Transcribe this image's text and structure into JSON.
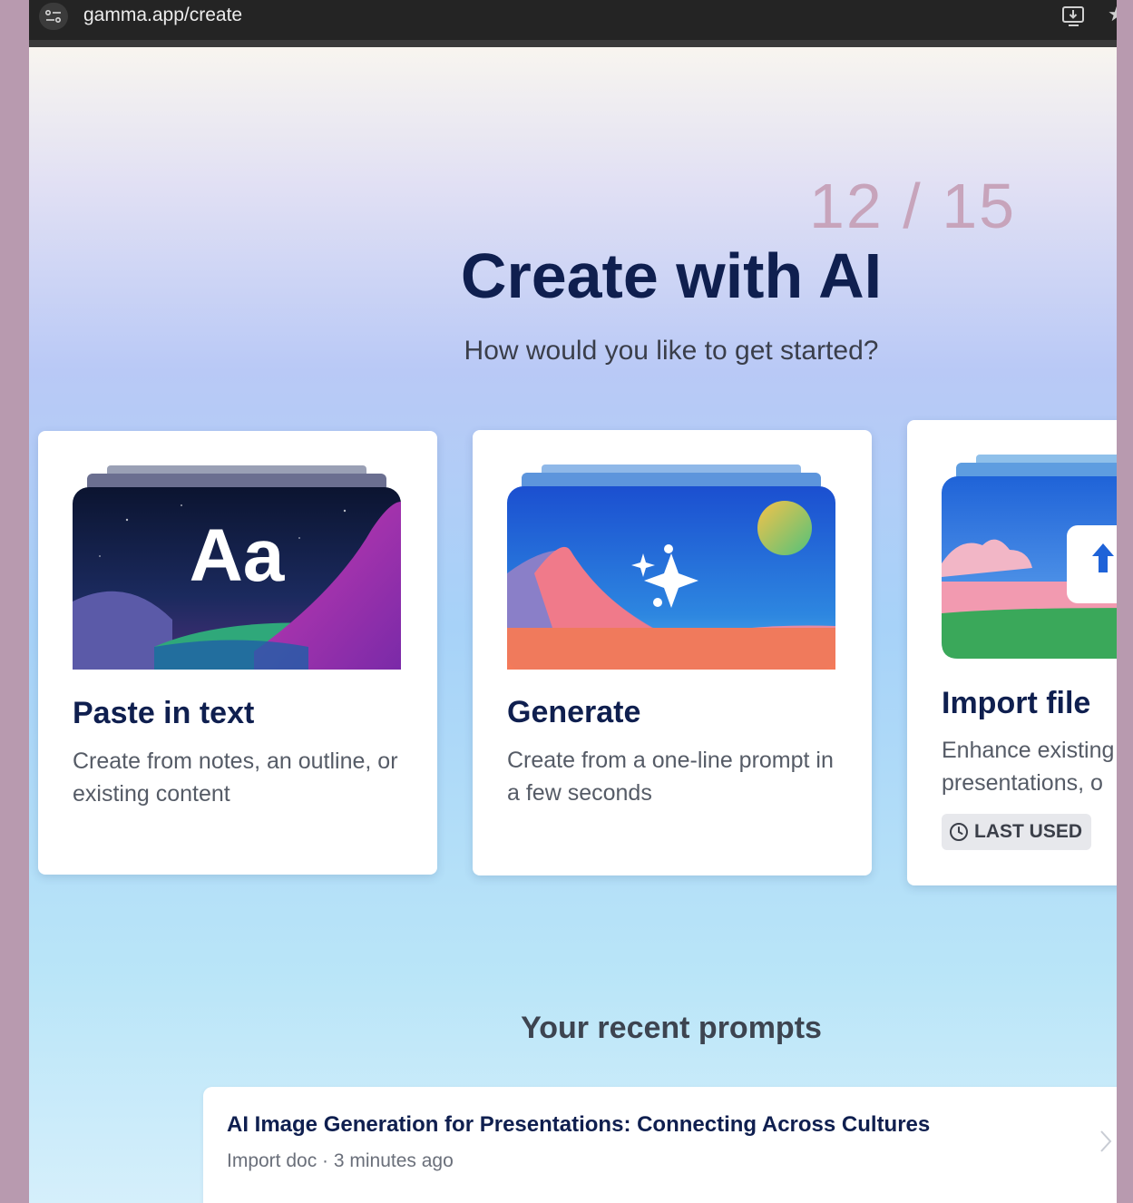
{
  "browser": {
    "url": "gamma.app/create"
  },
  "slide_counter": "12 / 15",
  "main": {
    "title": "Create with AI",
    "subtitle": "How would you like to get started?"
  },
  "cards": [
    {
      "title": "Paste in text",
      "description": "Create from notes, an outline, or existing content",
      "art_glyph": "Aa"
    },
    {
      "title": "Generate",
      "description": "Create from a one-line prompt in a few seconds"
    },
    {
      "title": "Import file",
      "description_line1": "Enhance existing",
      "description_line2": "presentations, o",
      "badge": "LAST USED"
    }
  ],
  "recent": {
    "heading": "Your recent prompts",
    "items": [
      {
        "title": "AI Image Generation for Presentations: Connecting Across Cultures",
        "meta": "Import doc · 3 minutes ago"
      }
    ]
  },
  "colors": {
    "title_navy": "#0f1f4f",
    "counter_mauve": "#c7a4bb",
    "frame_background": "#b89aaf"
  }
}
